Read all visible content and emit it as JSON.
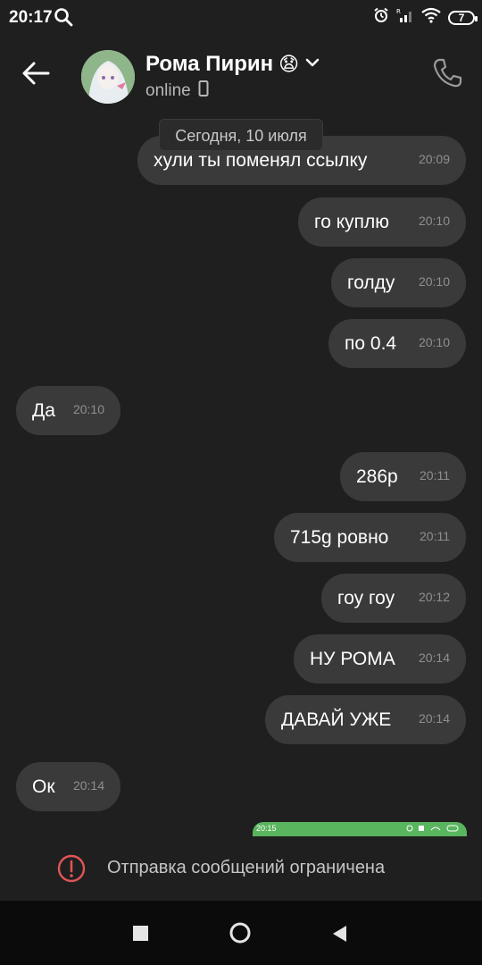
{
  "statusbar": {
    "time": "20:17",
    "battery": "7",
    "icons": [
      "search-icon",
      "alarm-icon",
      "signal-icon",
      "wifi-icon",
      "battery-icon"
    ]
  },
  "header": {
    "contact_name": "Рома Пирин",
    "emoji": "😧",
    "status": "online",
    "icons": [
      "back-arrow-icon",
      "chevron-down-icon",
      "mobile-icon",
      "phone-icon"
    ]
  },
  "date_divider": "Сегодня, 10 июля",
  "messages": [
    {
      "side": "out",
      "text": "хули ты поменял ссылку",
      "time": "20:09"
    },
    {
      "side": "out",
      "text": "го куплю",
      "time": "20:10"
    },
    {
      "side": "out",
      "text": "голду",
      "time": "20:10"
    },
    {
      "side": "out",
      "text": "по 0.4",
      "time": "20:10"
    },
    {
      "side": "in",
      "text": "Да",
      "time": "20:10"
    },
    {
      "side": "out",
      "text": "286р",
      "time": "20:11"
    },
    {
      "side": "out",
      "text": "715g ровно",
      "time": "20:11"
    },
    {
      "side": "out",
      "text": "гоу гоу",
      "time": "20:12"
    },
    {
      "side": "out",
      "text": "НУ РОМА",
      "time": "20:14"
    },
    {
      "side": "out",
      "text": "ДАВАЙ УЖЕ",
      "time": "20:14"
    },
    {
      "side": "in",
      "text": "Ок",
      "time": "20:14"
    }
  ],
  "screenshot_preview": {
    "time": "20:15"
  },
  "restriction": {
    "text": "Отправка сообщений ограничена"
  },
  "colors": {
    "background": "#1f1f1f",
    "bubble": "#3a3a3a",
    "warning": "#e05555",
    "preview_green": "#59b55e"
  }
}
